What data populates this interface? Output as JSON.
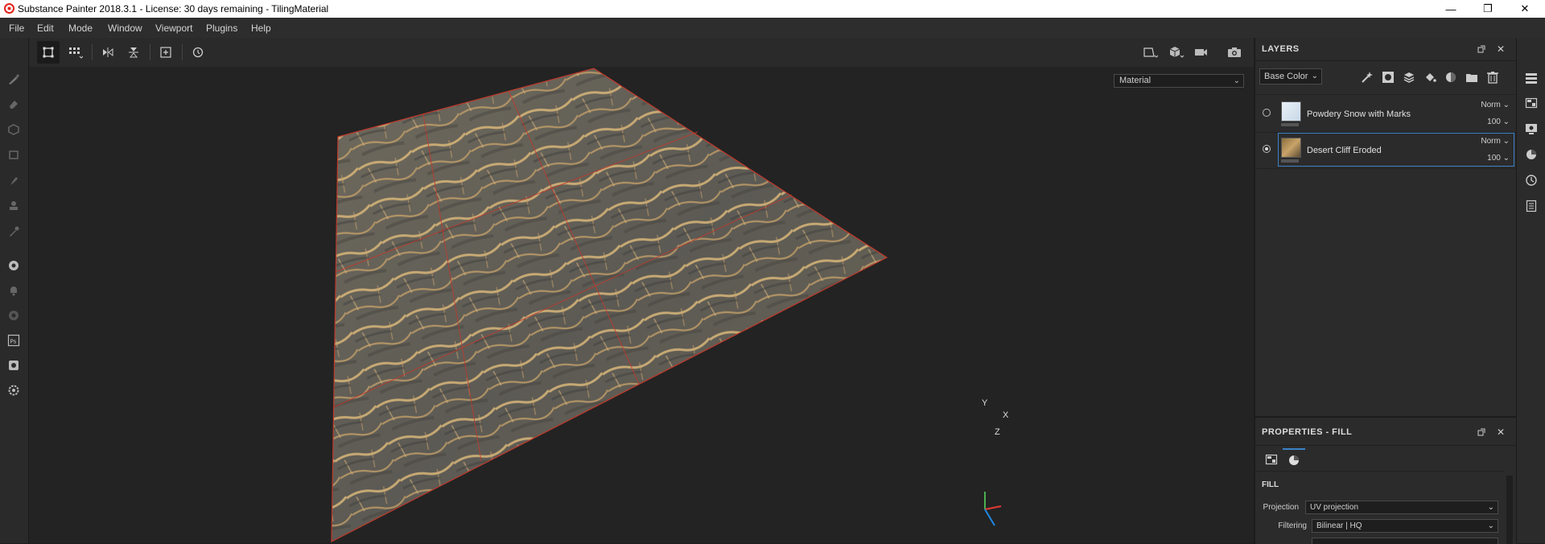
{
  "window": {
    "title": "Substance Painter 2018.3.1 - License: 30 days remaining - TilingMaterial",
    "controls": {
      "minimize": "—",
      "maximize": "❐",
      "close": "✕"
    }
  },
  "menu": [
    "File",
    "Edit",
    "Mode",
    "Window",
    "Viewport",
    "Plugins",
    "Help"
  ],
  "viewport": {
    "display_mode": "Material",
    "axes": {
      "y": "Y",
      "x": "X",
      "z": "Z"
    }
  },
  "layers": {
    "title": "LAYERS",
    "channel": "Base Color",
    "items": [
      {
        "name": "Powdery Snow with Marks",
        "blend": "Norm",
        "opacity": "100",
        "visible": false,
        "selected": false
      },
      {
        "name": "Desert Cliff Eroded",
        "blend": "Norm",
        "opacity": "100",
        "visible": true,
        "selected": true
      }
    ]
  },
  "properties": {
    "title": "PROPERTIES - FILL",
    "section": "FILL",
    "projection_label": "Projection",
    "projection_value": "UV projection",
    "filtering_label": "Filtering",
    "filtering_value": "Bilinear | HQ"
  },
  "colors": {
    "accent": "#3b82c9",
    "panel": "#2b2b2b",
    "viewport": "#232323",
    "uv_grid": "#c0392b"
  }
}
